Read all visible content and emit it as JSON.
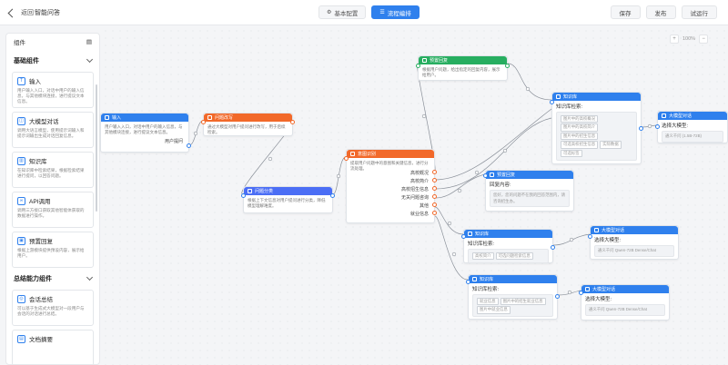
{
  "header": {
    "back_label": "返回",
    "app_title": "智能问答",
    "tabs": [
      {
        "label": "基本配置",
        "icon": "sliders-icon",
        "active": false
      },
      {
        "label": "流程编排",
        "icon": "list-icon",
        "active": true
      }
    ],
    "actions": [
      "保存",
      "发布",
      "试运行"
    ]
  },
  "sidebar": {
    "header": "组件",
    "sections": [
      {
        "title": "基础组件",
        "items": [
          {
            "title": "输入",
            "desc": "用户输入入口，对话中用户的输入信息，与其他模块连接，进行提议文本信息。"
          },
          {
            "title": "大模型对话",
            "desc": "调用大语言模型，使用提示词输入和提示词输出生成对话回复信息。"
          },
          {
            "title": "知识库",
            "desc": "在知识库中检索结果，根据检索结果进行提问，以回答问题。"
          },
          {
            "title": "API调用",
            "desc": "调用三方接口获取其他智能体获取的数据进行操作。"
          },
          {
            "title": "预置回复",
            "desc": "根据上游模块提供预设内容，展示给用户。"
          }
        ]
      },
      {
        "title": "总结能力组件",
        "items": [
          {
            "title": "会话总结",
            "desc": "可以基于生成式大模型对一段用户与会话的对话进行总结。"
          },
          {
            "title": "文档摘要",
            "desc": ""
          }
        ]
      }
    ]
  },
  "canvas": {
    "zoom": "100%",
    "nodes": {
      "input": {
        "title": "输入",
        "desc": "用户输入入口，对话中用户的输入信息，与其他模块连接，进行提议文本信息。",
        "output": "用户提问"
      },
      "rewrite": {
        "title": "问题改写",
        "desc": "通过大模型对用户提问进行改写，用于后续检索。"
      },
      "classify_pre": {
        "title": "问题分类",
        "desc": "根据上下文信息对用户提问进行分类，降低模型理解难度。"
      },
      "intent": {
        "title": "意图识别",
        "desc": "提取用户问题中的意图和关键信息，进行分流处理。",
        "outputs": [
          "高校概况",
          "高校简介",
          "高校招生信息",
          "无关问题咨询",
          "其他",
          "就业信息"
        ]
      },
      "reply_top": {
        "title": "预置回复",
        "desc": "根据用户问题，给出指定的回复内容，展示给用户。"
      },
      "kb_top": {
        "title": "知识库",
        "label": "知识库检索:",
        "chips": [
          "图片中的高校概况",
          "图片中的高校简介",
          "图片中的招生信息",
          "可选高校招生信息",
          "实际数据",
          "可选标签"
        ]
      },
      "llm_top": {
        "title": "大模型对话",
        "label": "选择大模型:",
        "value": "通义千问 (1.5B-72B)"
      },
      "reply_mid": {
        "title": "预置回复",
        "label": "回复内容:",
        "value": "您好，您的问题不在我的回答范围内，请咨询招生办。"
      },
      "kb_mid": {
        "title": "知识库",
        "label": "知识库检索:",
        "chips": [
          "高校简介",
          "可选问题检索信息"
        ]
      },
      "llm_mid": {
        "title": "大模型对话",
        "label": "选择大模型:",
        "value": "通义千问 Qwen-72B Dense/Chat"
      },
      "kb_bot": {
        "title": "知识库",
        "label": "知识库检索:",
        "chips": [
          "就业信息",
          "图片中的招生就业信息",
          "图片中就业信息"
        ]
      },
      "llm_bot": {
        "title": "大模型对话",
        "label": "选择大模型:",
        "value": "通义千问 Qwen-72B Dense/Chat"
      }
    }
  },
  "colors": {
    "primary": "#2f80ed",
    "orange": "#f2692a",
    "green": "#27ae60",
    "indigo": "#4b6ef5"
  }
}
